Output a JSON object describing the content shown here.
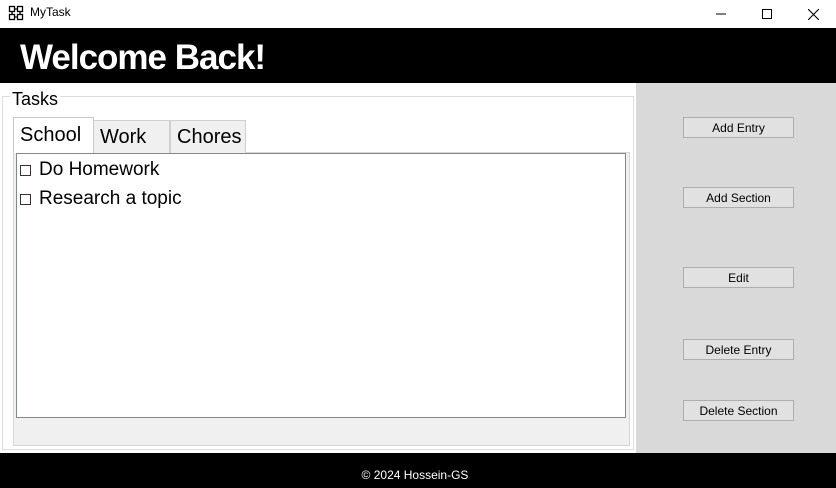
{
  "window": {
    "title": "MyTask",
    "icons": {
      "app": "app-icon",
      "minimize": "minimize-icon",
      "maximize": "maximize-icon",
      "close": "close-icon"
    }
  },
  "header": {
    "title": "Welcome Back!"
  },
  "tasks_group": {
    "label": "Tasks",
    "tabs": [
      {
        "label": "School",
        "selected": true
      },
      {
        "label": "Work",
        "selected": false
      },
      {
        "label": "Chores",
        "selected": false
      }
    ],
    "items": [
      {
        "label": "Do Homework",
        "checked": false
      },
      {
        "label": "Research a topic",
        "checked": false
      }
    ]
  },
  "actions": {
    "add_entry": "Add Entry",
    "add_section": "Add Section",
    "edit": "Edit",
    "delete_entry": "Delete Entry",
    "delete_section": "Delete Section"
  },
  "footer": {
    "text": "© 2024 Hossein-GS"
  },
  "colors": {
    "header_bg": "#000000",
    "panel_bg": "#d9d9d9",
    "button_bg": "#e1e1e1"
  }
}
